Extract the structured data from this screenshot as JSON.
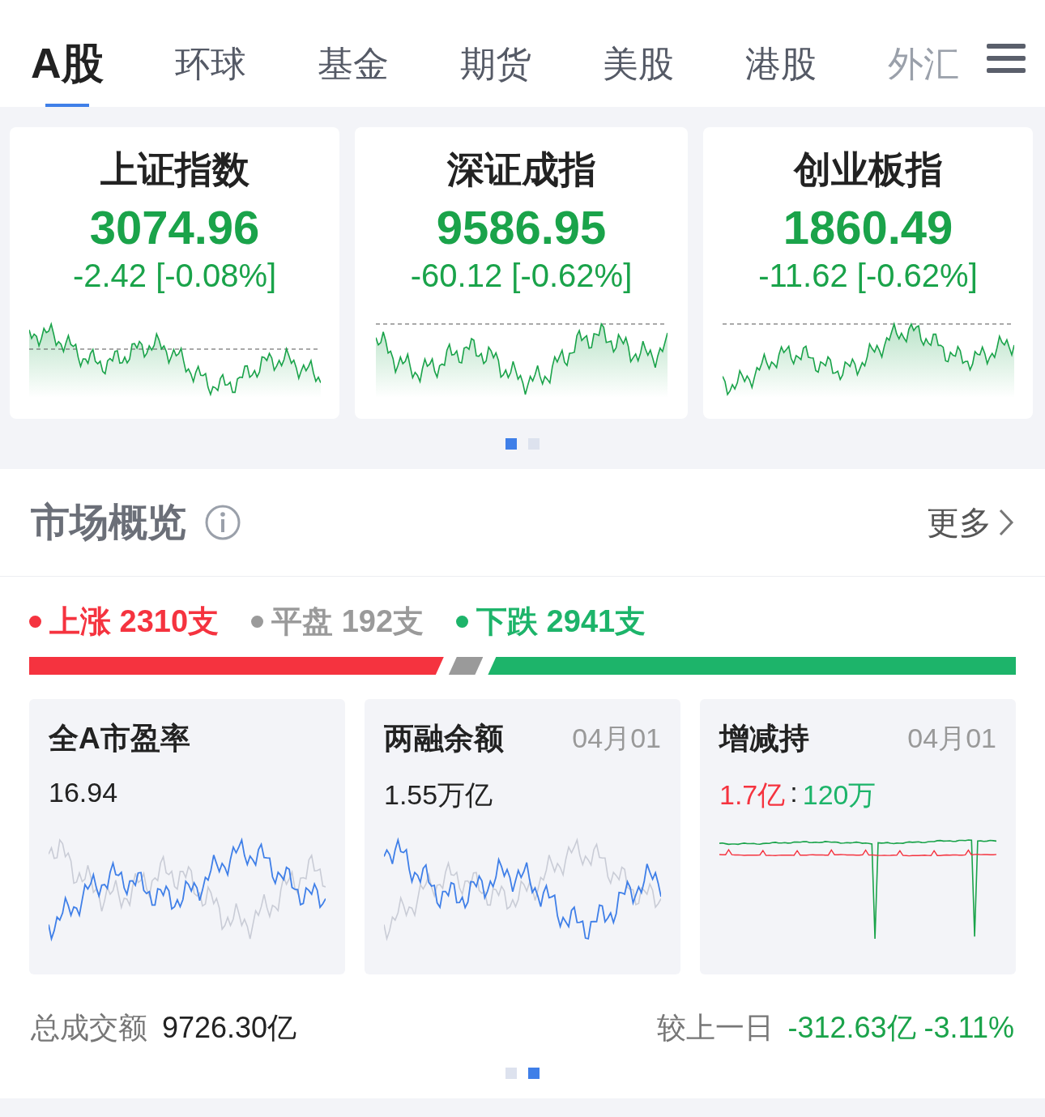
{
  "tabs": [
    {
      "label": "A股",
      "selected": true
    },
    {
      "label": "环球",
      "selected": false
    },
    {
      "label": "基金",
      "selected": false
    },
    {
      "label": "期货",
      "selected": false
    },
    {
      "label": "美股",
      "selected": false
    },
    {
      "label": "港股",
      "selected": false
    },
    {
      "label": "外汇",
      "selected": false
    }
  ],
  "indices": [
    {
      "name": "上证指数",
      "value": "3074.96",
      "change": "-2.42 [-0.08%]"
    },
    {
      "name": "深证成指",
      "value": "9586.95",
      "change": "-60.12 [-0.62%]"
    },
    {
      "name": "创业板指",
      "value": "1860.49",
      "change": "-11.62 [-0.62%]"
    }
  ],
  "index_pager": [
    {
      "selected": true
    },
    {
      "selected": false
    }
  ],
  "overview": {
    "title": "市场概览",
    "more": "更多",
    "breadth": [
      {
        "label": "上涨 2310支",
        "color": "#f5333f"
      },
      {
        "label": "平盘 192支",
        "color": "#9a9a9a"
      },
      {
        "label": "下跌 2941支",
        "color": "#1db46a"
      }
    ],
    "cards": [
      {
        "title": "全A市盈率",
        "value_parts": [
          {
            "text": "16.94",
            "color": "#222222"
          }
        ]
      },
      {
        "title": "两融余额",
        "date": "04月01",
        "value_parts": [
          {
            "text": "1.55万亿",
            "color": "#222222"
          }
        ]
      },
      {
        "title": "增减持",
        "date": "04月01",
        "value_parts": [
          {
            "text": "1.7亿",
            "color": "#f5333f"
          },
          {
            "text": ":",
            "color": "#222222"
          },
          {
            "text": "120万",
            "color": "#1db46a"
          }
        ]
      }
    ],
    "turnover_label": "总成交额",
    "turnover_value": "9726.30亿",
    "compare_label": "较上一日",
    "compare_value": "-312.63亿 -3.11%",
    "pager": [
      {
        "selected": false
      },
      {
        "selected": true
      }
    ]
  }
}
